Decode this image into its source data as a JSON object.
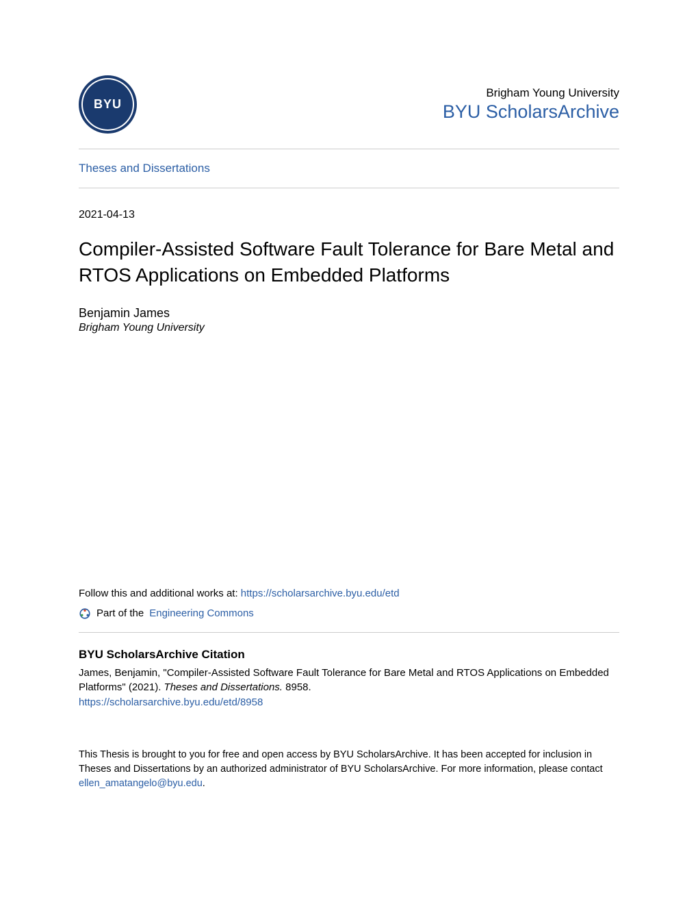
{
  "header": {
    "logo_text": "BYU",
    "university": "Brigham Young University",
    "archive": "BYU ScholarsArchive"
  },
  "nav": {
    "collection_link": "Theses and Dissertations"
  },
  "content": {
    "date": "2021-04-13",
    "title": "Compiler-Assisted Software Fault Tolerance for Bare Metal and RTOS Applications on Embedded Platforms",
    "author_name": "Benjamin James",
    "author_affiliation": "Brigham Young University"
  },
  "follow": {
    "prefix": "Follow this and additional works at: ",
    "url": "https://scholarsarchive.byu.edu/etd",
    "commons_prefix": "Part of the ",
    "commons_link": "Engineering Commons"
  },
  "citation": {
    "heading": "BYU ScholarsArchive Citation",
    "text_part1": "James, Benjamin, \"Compiler-Assisted Software Fault Tolerance for Bare Metal and RTOS Applications on Embedded Platforms\" (2021). ",
    "series": "Theses and Dissertations.",
    "text_part2": " 8958.",
    "link": "https://scholarsarchive.byu.edu/etd/8958"
  },
  "footer": {
    "text_part1": "This Thesis is brought to you for free and open access by BYU ScholarsArchive. It has been accepted for inclusion in Theses and Dissertations by an authorized administrator of BYU ScholarsArchive. For more information, please contact ",
    "email": "ellen_amatangelo@byu.edu",
    "text_part2": "."
  }
}
